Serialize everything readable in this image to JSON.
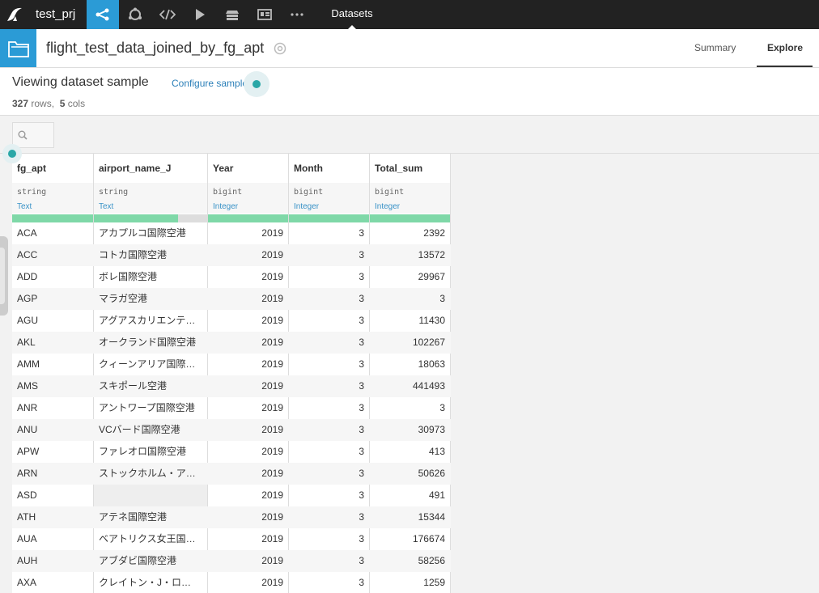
{
  "nav": {
    "project": "test_prj",
    "active_tab": "Datasets"
  },
  "header": {
    "dataset_name": "flight_test_data_joined_by_fg_apt",
    "tabs": [
      "Summary",
      "Explore"
    ]
  },
  "sample": {
    "title": "Viewing dataset sample",
    "configure_label": "Configure sample",
    "rows_count": "327",
    "rows_word": "rows,",
    "cols_count": "5",
    "cols_word": "cols"
  },
  "search": {
    "placeholder": ""
  },
  "columns": [
    {
      "name": "fg_apt",
      "storage": "string",
      "meaning": "Text",
      "valid_pct": 100
    },
    {
      "name": "airport_name_J",
      "storage": "string",
      "meaning": "Text",
      "valid_pct": 74
    },
    {
      "name": "Year",
      "storage": "bigint",
      "meaning": "Integer",
      "valid_pct": 100
    },
    {
      "name": "Month",
      "storage": "bigint",
      "meaning": "Integer",
      "valid_pct": 100
    },
    {
      "name": "Total_sum",
      "storage": "bigint",
      "meaning": "Integer",
      "valid_pct": 100
    }
  ],
  "rows": [
    [
      "ACA",
      "アカプルコ国際空港",
      "2019",
      "3",
      "2392"
    ],
    [
      "ACC",
      "コトカ国際空港",
      "2019",
      "3",
      "13572"
    ],
    [
      "ADD",
      "ボレ国際空港",
      "2019",
      "3",
      "29967"
    ],
    [
      "AGP",
      "マラガ空港",
      "2019",
      "3",
      "3"
    ],
    [
      "AGU",
      "アグアスカリエンテ…",
      "2019",
      "3",
      "11430"
    ],
    [
      "AKL",
      "オークランド国際空港",
      "2019",
      "3",
      "102267"
    ],
    [
      "AMM",
      "クィーンアリア国際…",
      "2019",
      "3",
      "18063"
    ],
    [
      "AMS",
      "スキポール空港",
      "2019",
      "3",
      "441493"
    ],
    [
      "ANR",
      "アントワープ国際空港",
      "2019",
      "3",
      "3"
    ],
    [
      "ANU",
      "VCバード国際空港",
      "2019",
      "3",
      "30973"
    ],
    [
      "APW",
      "ファレオロ国際空港",
      "2019",
      "3",
      "413"
    ],
    [
      "ARN",
      "ストックホルム・ア…",
      "2019",
      "3",
      "50626"
    ],
    [
      "ASD",
      "",
      "2019",
      "3",
      "491"
    ],
    [
      "ATH",
      "アテネ国際空港",
      "2019",
      "3",
      "15344"
    ],
    [
      "AUA",
      "ベアトリクス女王国…",
      "2019",
      "3",
      "176674"
    ],
    [
      "AUH",
      "アブダビ国際空港",
      "2019",
      "3",
      "58256"
    ],
    [
      "AXA",
      "クレイトン・J・ロ…",
      "2019",
      "3",
      "1259"
    ]
  ]
}
